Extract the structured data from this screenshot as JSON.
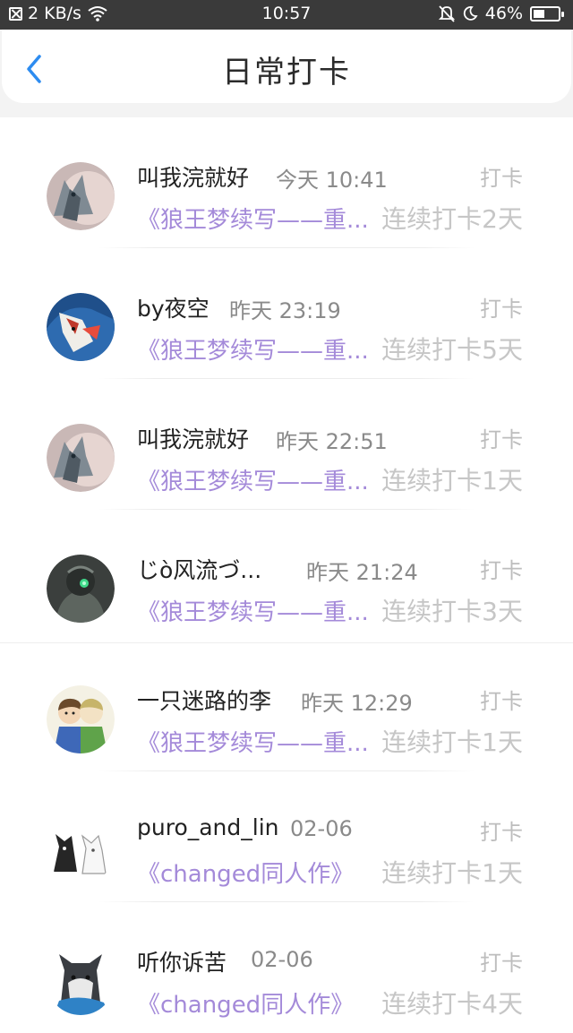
{
  "status_bar": {
    "speed": "2 KB/s",
    "time": "10:57",
    "battery": "46%",
    "battery_level": 0.46,
    "icons": [
      "sim-off-icon",
      "wifi-icon",
      "silent-bell-icon",
      "moon-icon",
      "battery-icon"
    ]
  },
  "header": {
    "title": "日常打卡",
    "back_icon": "chevron-left-icon",
    "accent": "#2d8cf0"
  },
  "colors": {
    "book_title": "#a48ad9",
    "streak": "#c6c6c6",
    "tag": "#bdbdbd"
  },
  "items": [
    {
      "nickname": "叫我浣就好",
      "time": "今天 10:41",
      "tag": "打卡",
      "book": "《狼王梦续写——重...",
      "streak": "连续打卡2天",
      "avatar": "wolf-avatar"
    },
    {
      "nickname": "by夜空",
      "time": "昨天 23:19",
      "tag": "打卡",
      "book": "《狼王梦续写——重...",
      "streak": "连续打卡5天",
      "avatar": "fox-art-avatar"
    },
    {
      "nickname": "叫我浣就好",
      "time": "昨天 22:51",
      "tag": "打卡",
      "book": "《狼王梦续写——重...",
      "streak": "连续打卡1天",
      "avatar": "wolf-avatar"
    },
    {
      "nickname": "じò风流づ...",
      "time": "昨天 21:24",
      "tag": "打卡",
      "book": "《狼王梦续写——重...",
      "streak": "连续打卡3天",
      "avatar": "soldier-avatar"
    },
    {
      "nickname": "一只迷路的李",
      "time": "昨天 12:29",
      "tag": "打卡",
      "book": "《狼王梦续写——重...",
      "streak": "连续打卡1天",
      "avatar": "cartoon-kids-avatar"
    },
    {
      "nickname": "puro_and_lin",
      "time": "02-06",
      "tag": "打卡",
      "book": "《changed同人作》",
      "streak": "连续打卡1天",
      "avatar": "cats-avatar"
    },
    {
      "nickname": "听你诉苦",
      "time": "02-06",
      "tag": "打卡",
      "book": "《changed同人作》",
      "streak": "连续打卡4天",
      "avatar": "husky-avatar"
    }
  ]
}
